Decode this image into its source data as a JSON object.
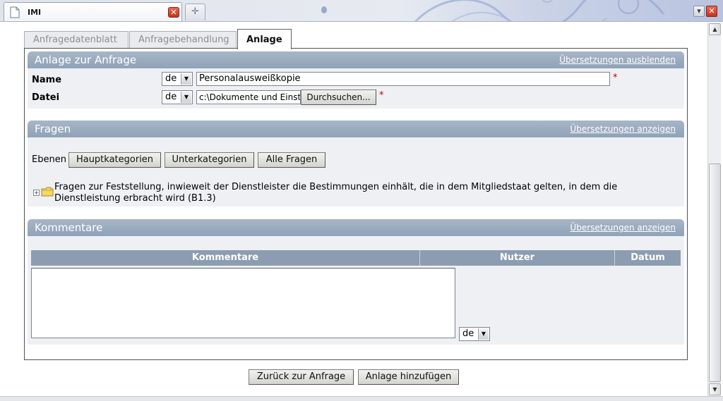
{
  "browser": {
    "tab_title": "IMI",
    "close_glyph": "✕",
    "new_tab_glyph": "✛",
    "minimize_glyph": "▾",
    "window_close_glyph": "✕"
  },
  "tabs": [
    {
      "label": "Anfragedatenblatt"
    },
    {
      "label": "Anfragebehandlung"
    },
    {
      "label": "Anlage"
    }
  ],
  "attachment": {
    "header": "Anlage zur Anfrage",
    "translations_link": "Übersetzungen ausblenden",
    "name_label": "Name",
    "name_lang": "de",
    "name_value": "Personalausweißkopie",
    "file_label": "Datei",
    "file_lang": "de",
    "file_value": "c:\\Dokumente und Einst",
    "browse_button": "Durchsuchen...",
    "required_mark": "*"
  },
  "questions": {
    "header": "Fragen",
    "translations_link": "Übersetzungen anzeigen",
    "levels_label": "Ebenen",
    "level_buttons": [
      "Hauptkategorien",
      "Unterkategorien",
      "Alle Fragen"
    ],
    "tree_item": "Fragen zur Feststellung, inwieweit der Dienstleister die Bestimmungen einhält, die in dem Mitgliedstaat gelten, in dem die Dienstleistung erbracht wird (B1.3)"
  },
  "comments": {
    "header": "Kommentare",
    "translations_link": "Übersetzungen anzeigen",
    "columns": [
      "Kommentare",
      "Nutzer",
      "Datum"
    ],
    "lang": "de"
  },
  "footer": {
    "back_button": "Zurück zur Anfrage",
    "add_button": "Anlage hinzufügen"
  },
  "colors": {
    "section_header": "#98a9bd",
    "section_body": "#eef0f3",
    "required": "#c00000"
  }
}
